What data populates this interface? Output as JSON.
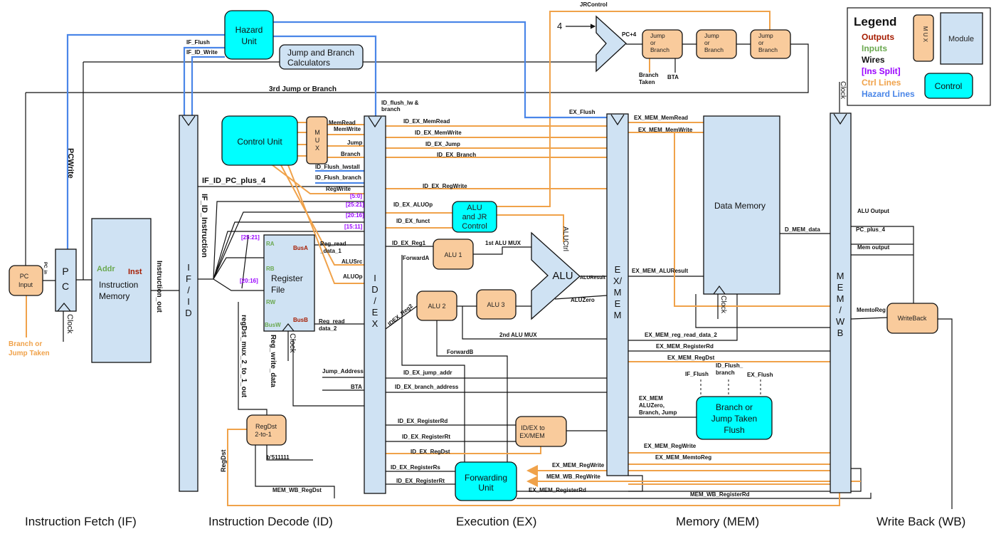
{
  "colors": {
    "module": "#cfe2f3",
    "mux": "#f9cb9c",
    "control": "#00ffff",
    "ctrl_line": "#f0a24a",
    "hazard_line": "#4a86e8",
    "outputs": "#a61c00",
    "inputs": "#6aa84f",
    "ins_split": "#9900ff"
  },
  "stages": [
    "Instruction Fetch (IF)",
    "Instruction Decode (ID)",
    "Execution (EX)",
    "Memory (MEM)",
    "Write Back (WB)"
  ],
  "legend": {
    "title": "Legend",
    "outputs": "Outputs",
    "inputs": "Inputs",
    "wires": "Wires",
    "ins_split": "[Ins Split]",
    "ctrl_lines": "Ctrl Lines",
    "hazard_lines": "Hazard Lines",
    "mux": "M U X",
    "module": "Module",
    "control": "Control"
  },
  "blocks": {
    "hazard_unit": [
      "Hazard",
      "Unit"
    ],
    "jb_calc": [
      "Jump and Branch",
      "Calculators"
    ],
    "jb1": [
      "Jump",
      "or",
      "Branch"
    ],
    "jb2": [
      "Jump",
      "or",
      "Branch"
    ],
    "jb3": [
      "Jump",
      "or",
      "Branch"
    ],
    "pc_input": [
      "PC",
      "Input"
    ],
    "pc": [
      "P",
      "C"
    ],
    "inst_mem": [
      "Instruction",
      "Memory"
    ],
    "if_id": [
      "I",
      "F",
      "/",
      "I",
      "D"
    ],
    "control_unit": "Control Unit",
    "cu_mux": [
      "M",
      "U",
      "X"
    ],
    "reg_file": [
      "Register",
      "File"
    ],
    "id_ex": [
      "I",
      "D",
      "/",
      "E",
      "X"
    ],
    "alu_jr": [
      "ALU",
      "and JR",
      "Control"
    ],
    "alu1": "ALU 1",
    "alu2": "ALU 2",
    "alu3": "ALU 3",
    "alu": "ALU",
    "ex_mem": [
      "E",
      "X/",
      "M",
      "E",
      "M"
    ],
    "data_mem": "Data Memory",
    "mem_wb": [
      "M",
      "E",
      "M",
      "/",
      "W",
      "B"
    ],
    "idex_to_exmem": [
      "ID/EX to",
      "EX/MEM"
    ],
    "forwarding": [
      "Forwarding",
      "Unit"
    ],
    "bj_flush": [
      "Branch or",
      "Jump Taken",
      "Flush"
    ],
    "regdst_mux": [
      "RegDst",
      "2-to-1"
    ],
    "writeback": "WriteBack"
  },
  "ports": {
    "addr": "Addr",
    "inst": "Inst",
    "ra": "RA",
    "rb": "RB",
    "rw": "RW",
    "busw": "BusW",
    "busa": "BusA",
    "busb": "BusB"
  },
  "labels": {
    "if_flush": "IF_Flush",
    "if_id_write": "IF_ID_Write",
    "pcwrite": "PCWrite",
    "third_jb": "3rd Jump or Branch",
    "jrcontrol": "JRControl",
    "four": "4",
    "pc_plus_4": "PC+4",
    "branch_taken_1": "Branch",
    "branch_taken_2": "Taken",
    "bta_top": "BTA",
    "id_flush_lw_1": "ID_flush_lw &",
    "id_flush_lw_2": "branch",
    "ex_flush": "EX_Flush",
    "memread": "MemRead",
    "memwrite": "MemWrite",
    "jump": "Jump",
    "branch": "Branch",
    "id_flush_lwstall": "ID_Flush_lwstall",
    "id_flush_branch": "ID_Flush_branch",
    "if_id_pc_plus_4": "IF_ID_PC_plus_4",
    "regwrite": "RegWrite",
    "s_5_0": "[5:0]",
    "s_25_21": "[25:21]",
    "s_20_16": "[20:16]",
    "s_15_11": "[15:11]",
    "rf_25_21": "[25:21]",
    "rf_20_16": "[20:16]",
    "if_id_instruction": "IF_ID_Instruction",
    "reg_read_1a": "Reg_read",
    "reg_read_1b": "_data_1",
    "alusrc": "ALUSrc",
    "aluop": "ALUOp",
    "instruction_out": "Instruction_out",
    "reg_read_2a": "Reg_read",
    "reg_read_2b": "data_2",
    "id_ex_memread": "ID_EX_MemRead",
    "id_ex_memwrite": "ID_EX_MemWrite",
    "id_ex_jump": "ID_EX_Jump",
    "id_ex_branch": "ID_EX_Branch",
    "id_ex_regwrite": "ID_EX_RegWrite",
    "id_ex_aluop": "ID_EX_ALUOp",
    "id_ex_funct": "ID_EX_funct",
    "id_ex_reg1": "ID_EX_Reg1",
    "forwarda": "ForwardA",
    "idex_reg2": "IDEX_Reg2",
    "alu_mux_1": "1st ALU MUX",
    "aluctrl": "ALUCtrl",
    "aluresult": "ALUResult",
    "aluzero": "ALUZero",
    "alu_mux_2": "2nd ALU MUX",
    "forwardb": "ForwardB",
    "ex_mem_memread": "EX_MEM_MemRead",
    "ex_mem_memwrite": "EX_MEM_MemWrite",
    "ex_mem_aluresult": "EX_MEM_ALUResult",
    "ex_mem_reg_read_data_2": "EX_MEM_reg_read_data_2",
    "ex_mem_registerrd": "EX_MEM_RegisterRd",
    "ex_mem_regdst": "EX_MEM_RegDst",
    "flush_if": "IF_Flush",
    "flush_id_1": "ID_Flush_",
    "flush_id_2": "branch",
    "flush_ex": "EX_Flush",
    "exmem_sig_1": "EX_MEM",
    "exmem_sig_2": "ALUZero,",
    "exmem_sig_3": "Branch, Jump",
    "ex_mem_regwrite": "EX_MEM_RegWrite",
    "ex_mem_memtoreg": "EX_MEM_MemtoReg",
    "d_mem_data": "D_MEM_data",
    "alu_output": "ALU Output",
    "pc_plus_4_wb": "PC_plus_4",
    "mem_output": "Mem output",
    "memtoreg": "MemtoReg",
    "jump_address": "Jump_Address",
    "bta": "BTA",
    "id_ex_jump_addr": "ID_EX_jump_addr",
    "id_ex_branch_address": "ID_EX_branch_address",
    "id_ex_registerrd": "ID_EX_RegisterRd",
    "id_ex_registerrt": "ID_EX_RegisterRt",
    "id_ex_regdst": "ID_EX_RegDst",
    "id_ex_registerrs": "ID_EX_RegisterRs",
    "id_ex_registerrt_fw": "ID_EX_RegisterRt",
    "fw_ex_mem_regwrite": "EX_MEM_RegWrite",
    "fw_mem_wb_regwrite": "MEM_WB_RegWrite",
    "fw_ex_mem_registerrd": "EX_MEM_RegisterRd",
    "mem_wb_registerrd": "MEM_WB_RegisterRd",
    "regdst_mux_out": "regDst_mux_2_to_1_out",
    "reg_write_data": "Reg_write_data",
    "b511111": "b'511111",
    "mem_wb_regdst": "MEM_WB_RegDst",
    "regdst": "RegDst",
    "pc_in": "PC_in",
    "bj_taken_1": "Branch or",
    "bj_taken_2": "Jump Taken",
    "clock_pc": "Clock",
    "clock_rf": "Clock",
    "clock_dm": "Clock",
    "clock_wb": "Clock"
  }
}
